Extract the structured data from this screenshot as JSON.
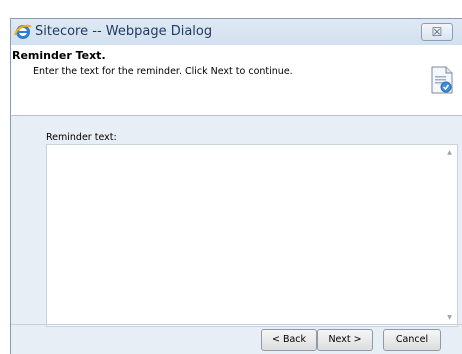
{
  "window": {
    "title": "Sitecore -- Webpage Dialog",
    "close_label": "☒"
  },
  "header": {
    "title": "Reminder Text.",
    "description": "Enter the text for the reminder. Click Next to continue."
  },
  "form": {
    "label": "Reminder text:",
    "value": ""
  },
  "buttons": {
    "back": "< Back",
    "next": "Next >",
    "cancel": "Cancel"
  },
  "colors": {
    "title_text": "#1e3a5f",
    "window_bg": "#e8eef6",
    "header_bg": "#ffffff"
  },
  "icons": {
    "window": "internet-explorer-icon",
    "header": "document-reminder-icon",
    "close": "close-icon"
  }
}
